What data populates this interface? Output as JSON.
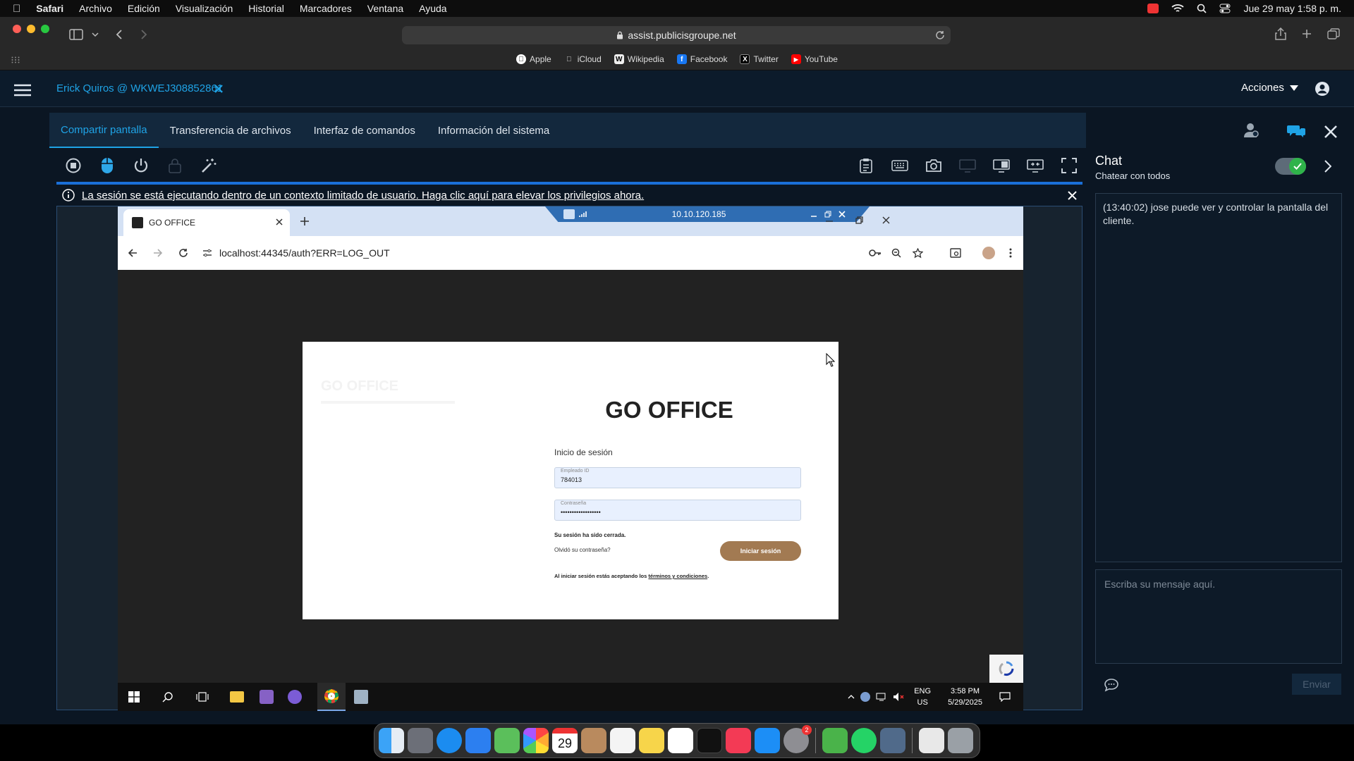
{
  "menubar": {
    "app": "Safari",
    "items": [
      "Archivo",
      "Edición",
      "Visualización",
      "Historial",
      "Marcadores",
      "Ventana",
      "Ayuda"
    ],
    "datetime": "Jue 29 may  1:58 p. m."
  },
  "safari": {
    "url": "assist.publicisgroupe.net",
    "favorites": [
      "Apple",
      "iCloud",
      "Wikipedia",
      "Facebook",
      "Twitter",
      "YouTube"
    ]
  },
  "app": {
    "session_title": "Erick Quiros @ WKWEJ308852861",
    "acciones": "Acciones",
    "tabs": [
      "Compartir pantalla",
      "Transferencia de archivos",
      "Interfaz de comandos",
      "Información del sistema"
    ],
    "notice": "La sesión se está ejecutando dentro de un contexto limitado de usuario. Haga clic aquí para elevar los privilegios ahora."
  },
  "remote": {
    "connection_ip": "10.10.120.185",
    "tab_title": "GO OFFICE",
    "url": "localhost:44345/auth?ERR=LOG_OUT",
    "login": {
      "ghost_title": "GO OFFICE",
      "title": "GO OFFICE",
      "heading": "Inicio de sesión",
      "employee_label": "Empleado ID",
      "employee_value": "784013",
      "password_label": "Contraseña",
      "password_value": "••••••••••••••••••",
      "session_closed": "Su sesión ha sido cerrada.",
      "forgot": "Olvidó su contraseña?",
      "submit": "Iniciar sesión",
      "terms_prefix": "Al iniciar sesión estás aceptando los",
      "terms_link": "términos y condiciones"
    },
    "taskbar": {
      "lang": "ENG",
      "region": "US",
      "time": "3:58 PM",
      "date": "5/29/2025"
    }
  },
  "chat": {
    "title": "Chat",
    "subtitle": "Chatear con todos",
    "message": "(13:40:02) jose puede ver y controlar la pantalla del cliente.",
    "placeholder": "Escriba su mensaje aquí.",
    "send": "Enviar"
  },
  "dock": {
    "calendar_day": "29",
    "settings_badge": "2"
  },
  "colors": {
    "accent": "#1fa3e6",
    "login_button": "#a27a52",
    "app_bg": "#0b1623"
  }
}
